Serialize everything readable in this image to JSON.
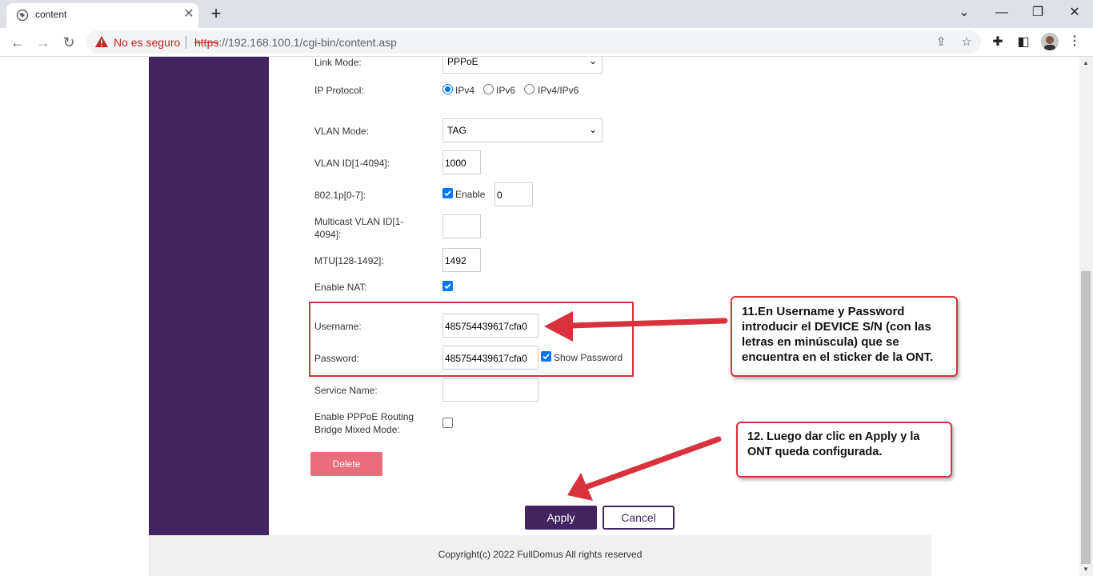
{
  "browser": {
    "tab_title": "content",
    "new_tab_label": "+",
    "security_label": "No es seguro",
    "url_scheme": "https",
    "url_rest": "://192.168.100.1/cgi-bin/content.asp",
    "window_controls": [
      "chevron-down-icon",
      "minimize-icon",
      "restore-icon",
      "close-icon"
    ]
  },
  "form": {
    "link_mode": {
      "label": "Link Mode:",
      "value": "PPPoE"
    },
    "ip_protocol": {
      "label": "IP Protocol:",
      "options": [
        "IPv4",
        "IPv6",
        "IPv4/IPv6"
      ],
      "selected": "IPv4"
    },
    "vlan_mode": {
      "label": "VLAN Mode:",
      "value": "TAG"
    },
    "vlan_id": {
      "label": "VLAN ID[1-4094]:",
      "value": "1000"
    },
    "p8021": {
      "label": "802.1p[0-7]:",
      "enable_label": "Enable",
      "checked": true,
      "value": "0"
    },
    "multicast_vlan": {
      "label_line1": "Multicast VLAN ID[1-",
      "label_line2": "4094]:",
      "value": ""
    },
    "mtu": {
      "label": "MTU[128-1492]:",
      "value": "1492"
    },
    "enable_nat": {
      "label": "Enable NAT:",
      "checked": true
    },
    "username": {
      "label": "Username:",
      "value": "485754439617cfa0"
    },
    "password": {
      "label": "Password:",
      "value": "485754439617cfa0",
      "show_password_label": "Show Password",
      "show_checked": true
    },
    "service_name": {
      "label": "Service Name:",
      "value": ""
    },
    "pppoe_bridge": {
      "label_line1": "Enable PPPoE Routing",
      "label_line2": "Bridge Mixed Mode:",
      "checked": false
    },
    "delete_label": "Delete",
    "apply_label": "Apply",
    "cancel_label": "Cancel"
  },
  "footer": {
    "copyright": "Copyright(c) 2022 FullDomus All rights reserved"
  },
  "annotations": {
    "callout1": {
      "line1": "11.En Username y Password",
      "line2": "introducir el DEVICE S/N (con las",
      "line3": "letras en minúscula) que se",
      "line4": "encuentra en el sticker de la ONT."
    },
    "callout2": {
      "line1": "12. Luego dar clic en Apply y la",
      "line2": "ONT queda configurada."
    },
    "color": "#d9323c"
  },
  "colors": {
    "brand": "#432360",
    "delete": "#e96d7b",
    "accent": "#0075ff"
  }
}
